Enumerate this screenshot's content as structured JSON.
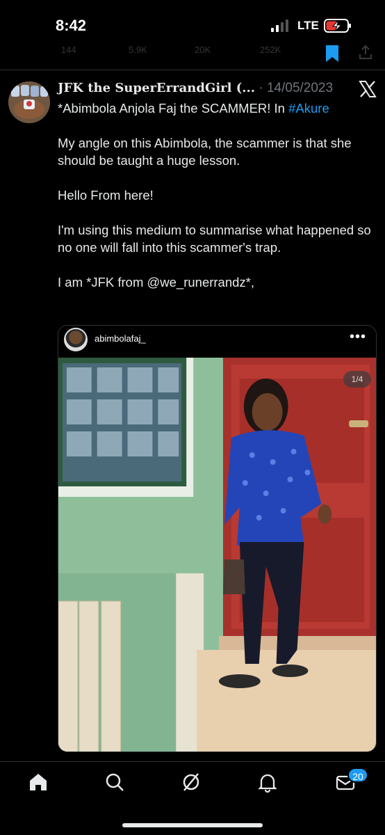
{
  "status_bar": {
    "time": "8:42",
    "network": "LTE",
    "battery_state": "charging"
  },
  "previous_tweet_actions": {
    "replies": "144",
    "reposts": "5.9K",
    "likes": "20K",
    "views": "252K"
  },
  "tweet": {
    "author_name": "JFK the SuperErrandGirl (...",
    "separator": "·",
    "date": "14/05/2023",
    "text_intro": "*Abimbola Anjola Faj the SCAMMER! In ",
    "hashtag": "#Akure",
    "paragraphs": [
      "My angle on this Abimbola, the scammer is that she should be taught a huge lesson.",
      "Hello From here!",
      "I'm using this medium to summarise what happened so no one will fall into this scammer's trap.",
      "I am *JFK from @we_runerrandz*,"
    ],
    "media": {
      "ig_username": "abimbolafaj_",
      "more_label": "•••",
      "counter": "1/4"
    }
  },
  "tab_bar": {
    "items": [
      "home",
      "search",
      "grok",
      "notifications",
      "messages"
    ],
    "messages_badge": "20"
  },
  "icons": {
    "x_logo": "x-logo-icon",
    "bookmark": "bookmark-icon",
    "share": "share-icon"
  },
  "colors": {
    "background": "#000000",
    "text": "#e7e9ea",
    "secondary_text": "#71767b",
    "accent": "#1d9bf0"
  }
}
